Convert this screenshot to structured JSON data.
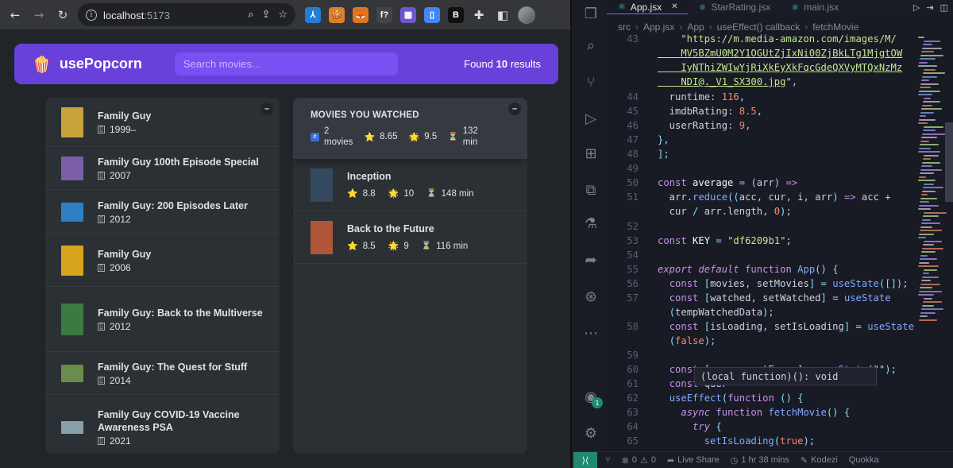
{
  "browser": {
    "url_host": "localhost",
    "url_port": ":5173",
    "extensions": [
      {
        "name": "extension-a-icon",
        "glyph": "⅄",
        "color": "#1e7fd6"
      },
      {
        "name": "extension-cookie-icon",
        "glyph": "🍪",
        "color": "#d9822b"
      },
      {
        "name": "extension-fox-icon",
        "glyph": "🦊",
        "color": "#e2761b"
      },
      {
        "name": "extension-fx-icon",
        "glyph": "f?",
        "color": "#444"
      },
      {
        "name": "extension-grid-icon",
        "glyph": "▦",
        "color": "#6e56cf"
      },
      {
        "name": "extension-doc-icon",
        "glyph": "▯",
        "color": "#4285f4"
      },
      {
        "name": "extension-b-icon",
        "glyph": "B",
        "color": "#111"
      }
    ]
  },
  "app": {
    "brand": "usePopcorn",
    "search_placeholder": "Search movies...",
    "found_prefix": "Found ",
    "found_count": "10",
    "found_suffix": " results",
    "toggle_label": "–",
    "movies": [
      {
        "title": "Family Guy",
        "year": "1999–",
        "poster_color": "#c8a23a"
      },
      {
        "title": "Family Guy 100th Episode Special",
        "year": "2007",
        "poster_color": "#7a5fa6"
      },
      {
        "title": "Family Guy: 200 Episodes Later",
        "year": "2012",
        "poster_color": "#2f7fc4"
      },
      {
        "title": "Family Guy",
        "year": "2006",
        "poster_color": "#d8a31d"
      },
      {
        "title": "Family Guy: Back to the Multiverse",
        "year": "2012",
        "poster_color": "#3d7a43"
      },
      {
        "title": "Family Guy: The Quest for Stuff",
        "year": "2014",
        "poster_color": "#6b8c4a"
      },
      {
        "title": "Family Guy COVID-19 Vaccine Awareness PSA",
        "year": "2021",
        "poster_color": "#8aa0a8"
      }
    ],
    "summary": {
      "heading": "Movies you watched",
      "count": "2",
      "count_label": "movies",
      "imdb": "8.65",
      "user": "9.5",
      "runtime": "132",
      "runtime_unit": "min"
    },
    "watched": [
      {
        "title": "Inception",
        "imdb": "8.8",
        "user": "10",
        "runtime": "148 min",
        "poster_color": "#34495e"
      },
      {
        "title": "Back to the Future",
        "imdb": "8.5",
        "user": "9",
        "runtime": "116 min",
        "poster_color": "#b0553a"
      }
    ]
  },
  "vscode": {
    "tabs": [
      {
        "label": "App.jsx",
        "active": true
      },
      {
        "label": "StarRating.jsx",
        "active": false
      },
      {
        "label": "main.jsx",
        "active": false
      }
    ],
    "breadcrumb": [
      "src",
      "App.jsx",
      "App",
      "useEffect() callback",
      "fetchMovie"
    ],
    "tooltip": "(local function)(): void",
    "status": {
      "errors": "0",
      "warnings": "0",
      "live_share": "Live Share",
      "time": "1 hr 38 mins",
      "kodezi": "Kodezi",
      "quokka": "Quokka"
    },
    "notification_count": "1"
  }
}
